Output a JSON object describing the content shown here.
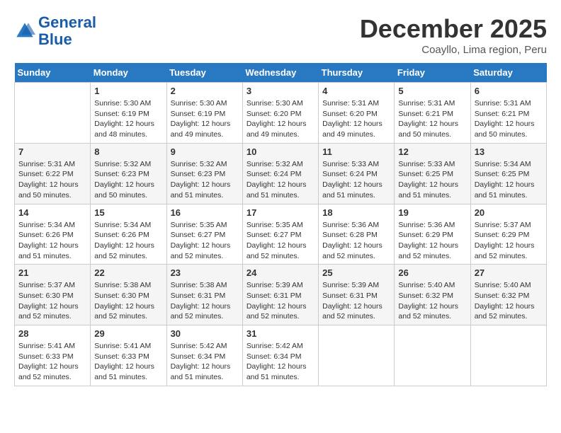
{
  "header": {
    "logo_line1": "General",
    "logo_line2": "Blue",
    "month_title": "December 2025",
    "subtitle": "Coayllo, Lima region, Peru"
  },
  "days_of_week": [
    "Sunday",
    "Monday",
    "Tuesday",
    "Wednesday",
    "Thursday",
    "Friday",
    "Saturday"
  ],
  "weeks": [
    [
      {
        "day": "",
        "sunrise": "",
        "sunset": "",
        "daylight": ""
      },
      {
        "day": "1",
        "sunrise": "Sunrise: 5:30 AM",
        "sunset": "Sunset: 6:19 PM",
        "daylight": "Daylight: 12 hours and 48 minutes."
      },
      {
        "day": "2",
        "sunrise": "Sunrise: 5:30 AM",
        "sunset": "Sunset: 6:19 PM",
        "daylight": "Daylight: 12 hours and 49 minutes."
      },
      {
        "day": "3",
        "sunrise": "Sunrise: 5:30 AM",
        "sunset": "Sunset: 6:20 PM",
        "daylight": "Daylight: 12 hours and 49 minutes."
      },
      {
        "day": "4",
        "sunrise": "Sunrise: 5:31 AM",
        "sunset": "Sunset: 6:20 PM",
        "daylight": "Daylight: 12 hours and 49 minutes."
      },
      {
        "day": "5",
        "sunrise": "Sunrise: 5:31 AM",
        "sunset": "Sunset: 6:21 PM",
        "daylight": "Daylight: 12 hours and 50 minutes."
      },
      {
        "day": "6",
        "sunrise": "Sunrise: 5:31 AM",
        "sunset": "Sunset: 6:21 PM",
        "daylight": "Daylight: 12 hours and 50 minutes."
      }
    ],
    [
      {
        "day": "7",
        "sunrise": "Sunrise: 5:31 AM",
        "sunset": "Sunset: 6:22 PM",
        "daylight": "Daylight: 12 hours and 50 minutes."
      },
      {
        "day": "8",
        "sunrise": "Sunrise: 5:32 AM",
        "sunset": "Sunset: 6:23 PM",
        "daylight": "Daylight: 12 hours and 50 minutes."
      },
      {
        "day": "9",
        "sunrise": "Sunrise: 5:32 AM",
        "sunset": "Sunset: 6:23 PM",
        "daylight": "Daylight: 12 hours and 51 minutes."
      },
      {
        "day": "10",
        "sunrise": "Sunrise: 5:32 AM",
        "sunset": "Sunset: 6:24 PM",
        "daylight": "Daylight: 12 hours and 51 minutes."
      },
      {
        "day": "11",
        "sunrise": "Sunrise: 5:33 AM",
        "sunset": "Sunset: 6:24 PM",
        "daylight": "Daylight: 12 hours and 51 minutes."
      },
      {
        "day": "12",
        "sunrise": "Sunrise: 5:33 AM",
        "sunset": "Sunset: 6:25 PM",
        "daylight": "Daylight: 12 hours and 51 minutes."
      },
      {
        "day": "13",
        "sunrise": "Sunrise: 5:34 AM",
        "sunset": "Sunset: 6:25 PM",
        "daylight": "Daylight: 12 hours and 51 minutes."
      }
    ],
    [
      {
        "day": "14",
        "sunrise": "Sunrise: 5:34 AM",
        "sunset": "Sunset: 6:26 PM",
        "daylight": "Daylight: 12 hours and 51 minutes."
      },
      {
        "day": "15",
        "sunrise": "Sunrise: 5:34 AM",
        "sunset": "Sunset: 6:26 PM",
        "daylight": "Daylight: 12 hours and 52 minutes."
      },
      {
        "day": "16",
        "sunrise": "Sunrise: 5:35 AM",
        "sunset": "Sunset: 6:27 PM",
        "daylight": "Daylight: 12 hours and 52 minutes."
      },
      {
        "day": "17",
        "sunrise": "Sunrise: 5:35 AM",
        "sunset": "Sunset: 6:27 PM",
        "daylight": "Daylight: 12 hours and 52 minutes."
      },
      {
        "day": "18",
        "sunrise": "Sunrise: 5:36 AM",
        "sunset": "Sunset: 6:28 PM",
        "daylight": "Daylight: 12 hours and 52 minutes."
      },
      {
        "day": "19",
        "sunrise": "Sunrise: 5:36 AM",
        "sunset": "Sunset: 6:29 PM",
        "daylight": "Daylight: 12 hours and 52 minutes."
      },
      {
        "day": "20",
        "sunrise": "Sunrise: 5:37 AM",
        "sunset": "Sunset: 6:29 PM",
        "daylight": "Daylight: 12 hours and 52 minutes."
      }
    ],
    [
      {
        "day": "21",
        "sunrise": "Sunrise: 5:37 AM",
        "sunset": "Sunset: 6:30 PM",
        "daylight": "Daylight: 12 hours and 52 minutes."
      },
      {
        "day": "22",
        "sunrise": "Sunrise: 5:38 AM",
        "sunset": "Sunset: 6:30 PM",
        "daylight": "Daylight: 12 hours and 52 minutes."
      },
      {
        "day": "23",
        "sunrise": "Sunrise: 5:38 AM",
        "sunset": "Sunset: 6:31 PM",
        "daylight": "Daylight: 12 hours and 52 minutes."
      },
      {
        "day": "24",
        "sunrise": "Sunrise: 5:39 AM",
        "sunset": "Sunset: 6:31 PM",
        "daylight": "Daylight: 12 hours and 52 minutes."
      },
      {
        "day": "25",
        "sunrise": "Sunrise: 5:39 AM",
        "sunset": "Sunset: 6:31 PM",
        "daylight": "Daylight: 12 hours and 52 minutes."
      },
      {
        "day": "26",
        "sunrise": "Sunrise: 5:40 AM",
        "sunset": "Sunset: 6:32 PM",
        "daylight": "Daylight: 12 hours and 52 minutes."
      },
      {
        "day": "27",
        "sunrise": "Sunrise: 5:40 AM",
        "sunset": "Sunset: 6:32 PM",
        "daylight": "Daylight: 12 hours and 52 minutes."
      }
    ],
    [
      {
        "day": "28",
        "sunrise": "Sunrise: 5:41 AM",
        "sunset": "Sunset: 6:33 PM",
        "daylight": "Daylight: 12 hours and 52 minutes."
      },
      {
        "day": "29",
        "sunrise": "Sunrise: 5:41 AM",
        "sunset": "Sunset: 6:33 PM",
        "daylight": "Daylight: 12 hours and 51 minutes."
      },
      {
        "day": "30",
        "sunrise": "Sunrise: 5:42 AM",
        "sunset": "Sunset: 6:34 PM",
        "daylight": "Daylight: 12 hours and 51 minutes."
      },
      {
        "day": "31",
        "sunrise": "Sunrise: 5:42 AM",
        "sunset": "Sunset: 6:34 PM",
        "daylight": "Daylight: 12 hours and 51 minutes."
      },
      {
        "day": "",
        "sunrise": "",
        "sunset": "",
        "daylight": ""
      },
      {
        "day": "",
        "sunrise": "",
        "sunset": "",
        "daylight": ""
      },
      {
        "day": "",
        "sunrise": "",
        "sunset": "",
        "daylight": ""
      }
    ]
  ]
}
